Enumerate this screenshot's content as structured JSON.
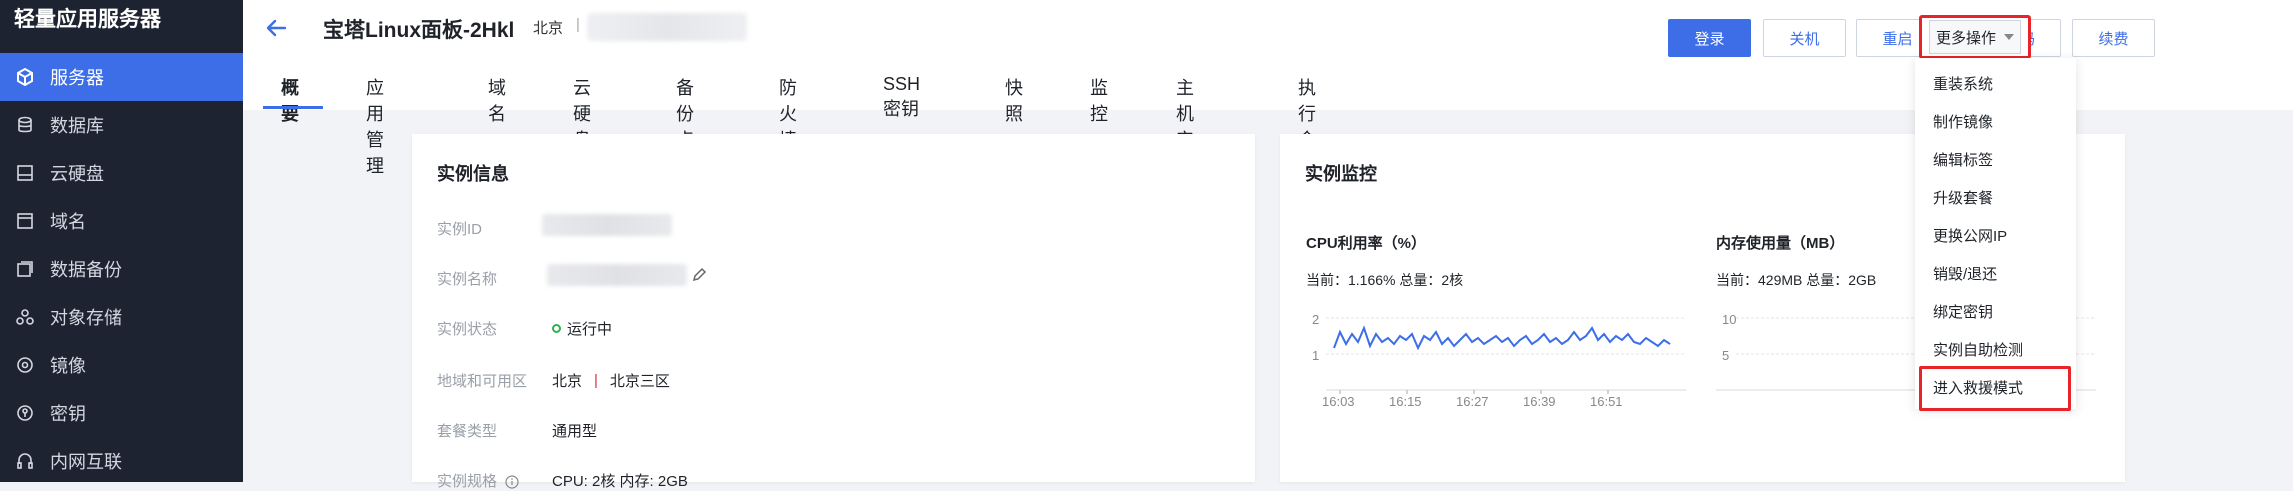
{
  "sidebar": {
    "title": "轻量应用服务器",
    "items": [
      {
        "label": "服务器",
        "icon": "server-icon",
        "active": true
      },
      {
        "label": "数据库",
        "icon": "database-icon"
      },
      {
        "label": "云硬盘",
        "icon": "disk-icon"
      },
      {
        "label": "域名",
        "icon": "domain-icon"
      },
      {
        "label": "数据备份",
        "icon": "backup-icon"
      },
      {
        "label": "对象存储",
        "icon": "storage-icon"
      },
      {
        "label": "镜像",
        "icon": "image-icon"
      },
      {
        "label": "密钥",
        "icon": "key-icon"
      },
      {
        "label": "内网互联",
        "icon": "network-icon"
      }
    ]
  },
  "header": {
    "title": "宝塔Linux面板-2Hkl",
    "region": "北京",
    "separator": "|",
    "buttons": {
      "login": "登录",
      "shutdown": "关机",
      "restart": "重启",
      "reset_password": "重置密码",
      "renew": "续费",
      "more": "更多操作"
    },
    "tabs": [
      "概要",
      "应用管理",
      "域名",
      "云硬盘",
      "备份点",
      "防火墙",
      "SSH密钥",
      "快照",
      "监控",
      "主机安全",
      "执行命令"
    ]
  },
  "instance_info": {
    "title": "实例信息",
    "rows": {
      "id_label": "实例ID",
      "name_label": "实例名称",
      "status_label": "实例状态",
      "status_value": "运行中",
      "region_label": "地域和可用区",
      "region_value": "北京",
      "zone_value": "北京三区",
      "plan_label": "套餐类型",
      "plan_value": "通用型",
      "spec_label": "实例规格",
      "spec_value": "CPU: 2核 内存: 2GB"
    }
  },
  "monitor": {
    "title": "实例监控",
    "cpu": {
      "title": "CPU利用率（%）",
      "current": "当前：1.166% 总量：2核",
      "y_ticks": [
        "2",
        "1"
      ],
      "x_ticks": [
        "16:03",
        "16:15",
        "16:27",
        "16:39",
        "16:51"
      ]
    },
    "memory": {
      "title": "内存使用量（MB）",
      "current": "当前：429MB 总量：2GB",
      "y_ticks": [
        "10",
        "5"
      ]
    }
  },
  "dropdown": {
    "items": [
      "重装系统",
      "制作镜像",
      "编辑标签",
      "升级套餐",
      "更换公网IP",
      "销毁/退还",
      "绑定密钥",
      "实例自助检测",
      "进入救援模式"
    ]
  },
  "colors": {
    "primary": "#3d6ee8",
    "sidebar_bg": "#1d2331",
    "highlight": "#e8232a",
    "status_running": "#30b050"
  }
}
